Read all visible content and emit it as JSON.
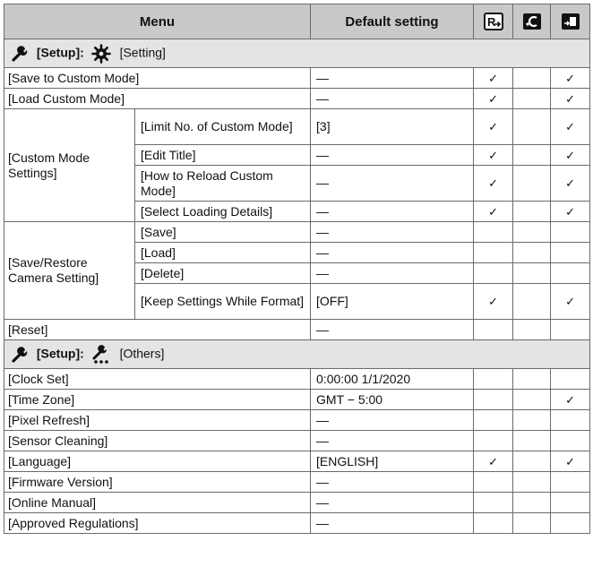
{
  "header": {
    "menu": "Menu",
    "default_setting": "Default setting",
    "icons": [
      "custom-mode-icon",
      "reset-icon",
      "save-restore-icon"
    ]
  },
  "section_setting": {
    "label": "[Setup]:",
    "sub": "[Setting]",
    "icon": "gear-icon"
  },
  "section_others": {
    "label": "[Setup]:",
    "sub": "[Others]",
    "icon": "others-icon"
  },
  "check": "✓",
  "rows": {
    "save_custom": {
      "label": "[Save to Custom Mode]",
      "default": "—"
    },
    "load_custom": {
      "label": "[Load Custom Mode]",
      "default": "—"
    },
    "custom_mode_settings": {
      "label": "[Custom Mode Settings]"
    },
    "limit_no": {
      "label": "[Limit No. of Custom Mode]",
      "default": "[3]"
    },
    "edit_title": {
      "label": "[Edit Title]",
      "default": "—"
    },
    "how_reload": {
      "label": "[How to Reload Custom Mode]",
      "default": "—"
    },
    "select_loading": {
      "label": "[Select Loading Details]",
      "default": "—"
    },
    "save_restore": {
      "label": "[Save/Restore Camera Setting]"
    },
    "save": {
      "label": "[Save]",
      "default": "—"
    },
    "load": {
      "label": "[Load]",
      "default": "—"
    },
    "delete": {
      "label": "[Delete]",
      "default": "—"
    },
    "keep_settings": {
      "label": "[Keep Settings While Format]",
      "default": "[OFF]"
    },
    "reset": {
      "label": "[Reset]",
      "default": "—"
    },
    "clock_set": {
      "label": "[Clock Set]",
      "default": "0:00:00 1/1/2020"
    },
    "time_zone": {
      "label": "[Time Zone]",
      "default": "GMT − 5:00"
    },
    "pixel_refresh": {
      "label": "[Pixel Refresh]",
      "default": "—"
    },
    "sensor_cleaning": {
      "label": "[Sensor Cleaning]",
      "default": "—"
    },
    "language": {
      "label": "[Language]",
      "default": "[ENGLISH]"
    },
    "firmware": {
      "label": "[Firmware Version]",
      "default": "—"
    },
    "online_manual": {
      "label": "[Online Manual]",
      "default": "—"
    },
    "approved_reg": {
      "label": "[Approved Regulations]",
      "default": "—"
    }
  }
}
